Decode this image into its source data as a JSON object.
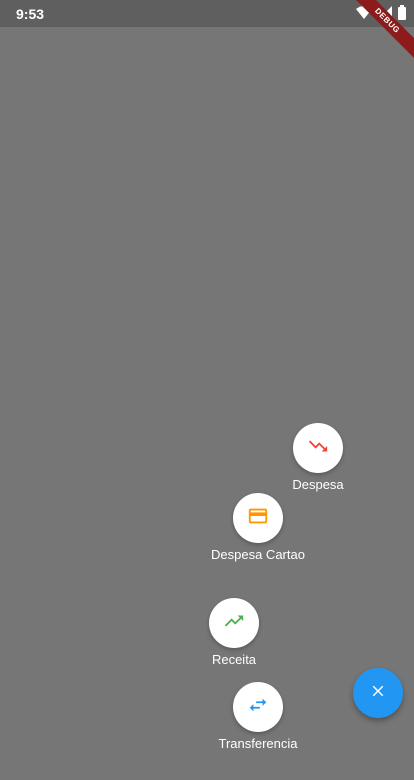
{
  "status_bar": {
    "time": "9:53",
    "icons": [
      "wifi-icon",
      "signal-icon",
      "battery-icon"
    ]
  },
  "debug_banner": {
    "label": "DEBUG"
  },
  "speed_dial": {
    "items": [
      {
        "label": "Despesa",
        "icon": "trending-down-icon",
        "color": "#f44336"
      },
      {
        "label": "Despesa Cartao",
        "icon": "credit-card-icon",
        "color": "#ff9800"
      },
      {
        "label": "Receita",
        "icon": "trending-up-icon",
        "color": "#4caf50"
      },
      {
        "label": "Transferencia",
        "icon": "swap-icon",
        "color": "#2196f3"
      }
    ],
    "main_button": {
      "icon": "close-icon",
      "color": "#2196f3"
    }
  }
}
